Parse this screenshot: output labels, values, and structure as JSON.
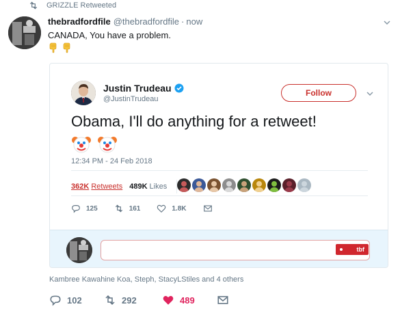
{
  "retweet_context": {
    "label": "GRIZZLE Retweeted",
    "icon": "retweet-icon"
  },
  "tweet": {
    "author_name": "thebradfordfile",
    "author_handle": "@thebradfordfile",
    "separator": "·",
    "time": "now",
    "text": "CANADA, You have a problem.",
    "emoji": [
      "pointing-down-hand",
      "pointing-down-hand"
    ]
  },
  "quoted_tweet": {
    "author_name": "Justin Trudeau",
    "author_handle": "@JustinTrudeau",
    "verified": true,
    "follow_label": "Follow",
    "text": "Obama, I'll do anything for a retweet!",
    "emoji": [
      "clown-face",
      "clown-face"
    ],
    "timestamp": "12:34 PM - 24 Feb 2018",
    "retweet_count": "362K",
    "retweet_label": "Retweets",
    "like_count": "489K",
    "like_label": "Likes",
    "likers_count": 9,
    "actions": {
      "reply": "125",
      "retweet": "161",
      "like": "1.8K"
    }
  },
  "reply_box": {
    "badge": "tbf"
  },
  "liked_by": "Kambree Kawahine Koa, Steph, StacyLStiles and 4 others",
  "actions": {
    "reply": "102",
    "retweet": "292",
    "like": "489"
  },
  "colors": {
    "accent_red": "#c9302c",
    "like_pink": "#e0245e",
    "verified_blue": "#1da1f2",
    "muted": "#657786",
    "reply_bg": "#e8f5fd"
  }
}
